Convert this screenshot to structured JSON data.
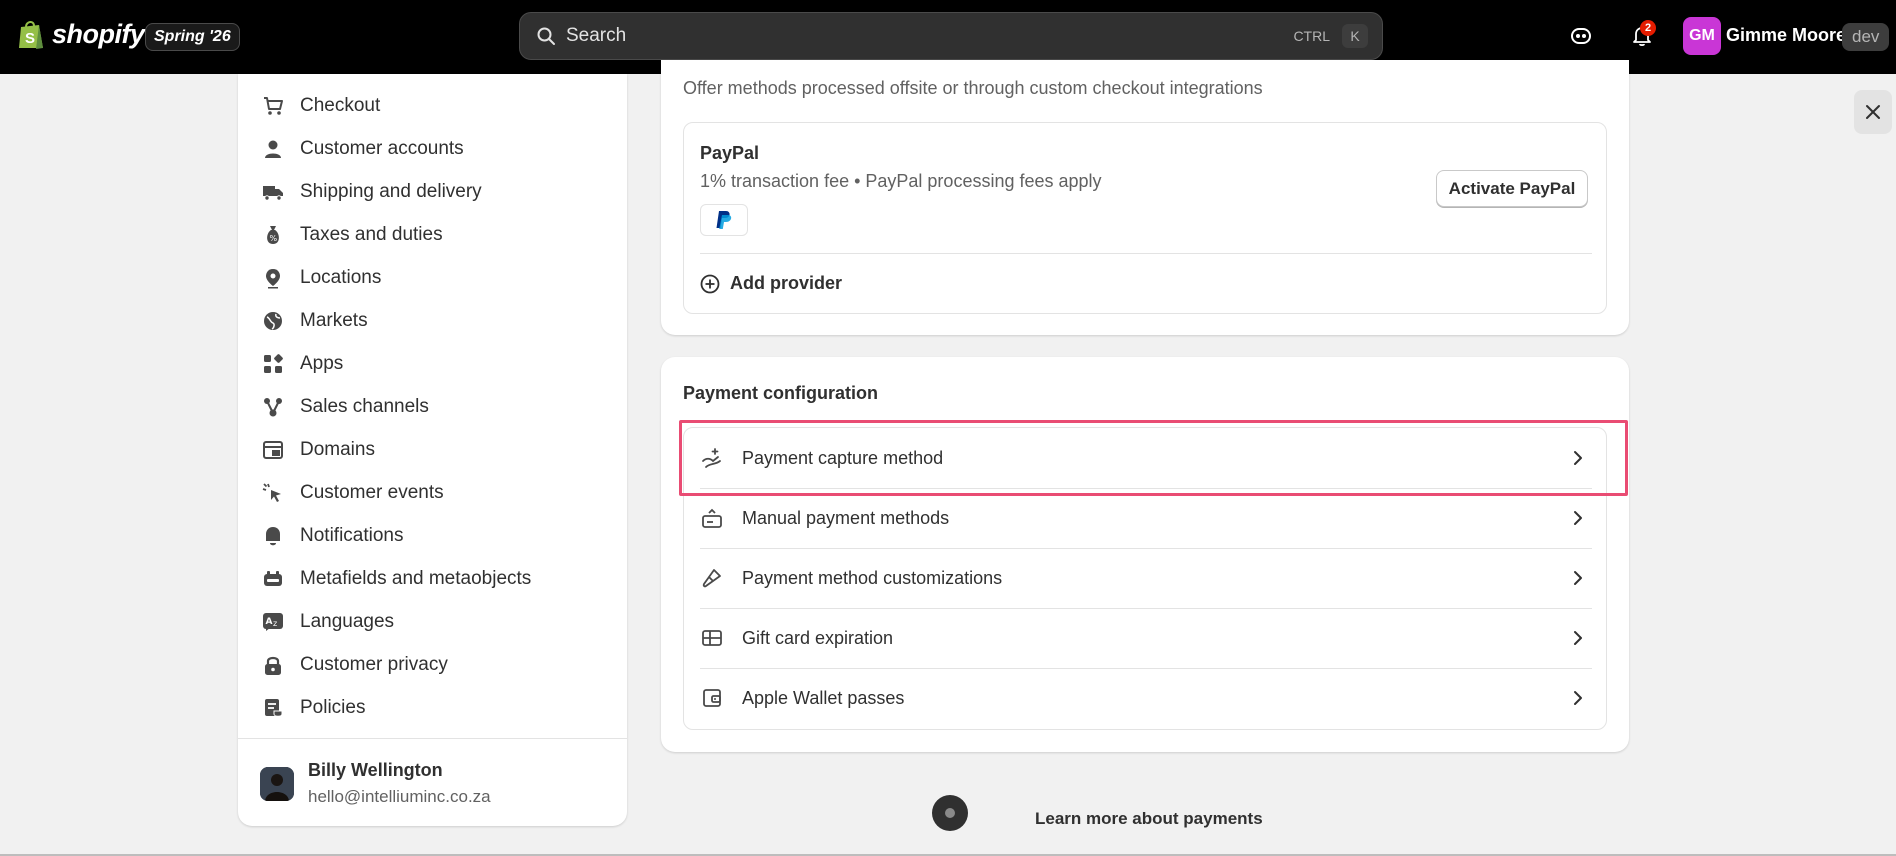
{
  "topbar": {
    "brand": "shopify",
    "edition": "Spring '26",
    "search_placeholder": "Search",
    "shortcut_ctrl": "CTRL",
    "shortcut_k": "K",
    "notification_count": "2",
    "user_initials": "GM",
    "user_name": "Gimme Moore",
    "user_tag": "dev"
  },
  "sidebar": {
    "items": [
      {
        "label": "Checkout",
        "icon": "cart-icon"
      },
      {
        "label": "Customer accounts",
        "icon": "person-icon"
      },
      {
        "label": "Shipping and delivery",
        "icon": "truck-icon"
      },
      {
        "label": "Taxes and duties",
        "icon": "tax-bag-icon"
      },
      {
        "label": "Locations",
        "icon": "location-pin-icon"
      },
      {
        "label": "Markets",
        "icon": "globe-icon"
      },
      {
        "label": "Apps",
        "icon": "apps-grid-icon"
      },
      {
        "label": "Sales channels",
        "icon": "sales-channels-icon"
      },
      {
        "label": "Domains",
        "icon": "domain-icon"
      },
      {
        "label": "Customer events",
        "icon": "cursor-click-icon"
      },
      {
        "label": "Notifications",
        "icon": "bell-icon"
      },
      {
        "label": "Metafields and metaobjects",
        "icon": "metafields-icon"
      },
      {
        "label": "Languages",
        "icon": "language-icon"
      },
      {
        "label": "Customer privacy",
        "icon": "lock-icon"
      },
      {
        "label": "Policies",
        "icon": "policy-icon"
      }
    ],
    "owner": {
      "name": "Billy Wellington",
      "email": "hello@intelliuminc.co.za"
    }
  },
  "supported_methods": {
    "description": "Offer methods processed offsite or through custom checkout integrations",
    "provider": {
      "name": "PayPal",
      "fee": "1% transaction fee • PayPal processing fees apply",
      "logo_letter": "P",
      "activate_label": "Activate PayPal"
    },
    "add_provider_label": "Add provider"
  },
  "payment_configuration": {
    "title": "Payment configuration",
    "rows": [
      {
        "label": "Payment capture method",
        "icon": "hand-capture-icon"
      },
      {
        "label": "Manual payment methods",
        "icon": "manual-payment-icon"
      },
      {
        "label": "Payment method customizations",
        "icon": "paint-brush-icon"
      },
      {
        "label": "Gift card expiration",
        "icon": "gift-card-icon"
      },
      {
        "label": "Apple Wallet passes",
        "icon": "wallet-icon"
      }
    ]
  },
  "footer": {
    "learn_more": "Learn more about payments"
  },
  "colors": {
    "topbar": "#000000",
    "page_bg": "#f1f1f1",
    "avatar": "#c936d6",
    "highlight": "#e94c73",
    "badge": "#e51c00"
  }
}
